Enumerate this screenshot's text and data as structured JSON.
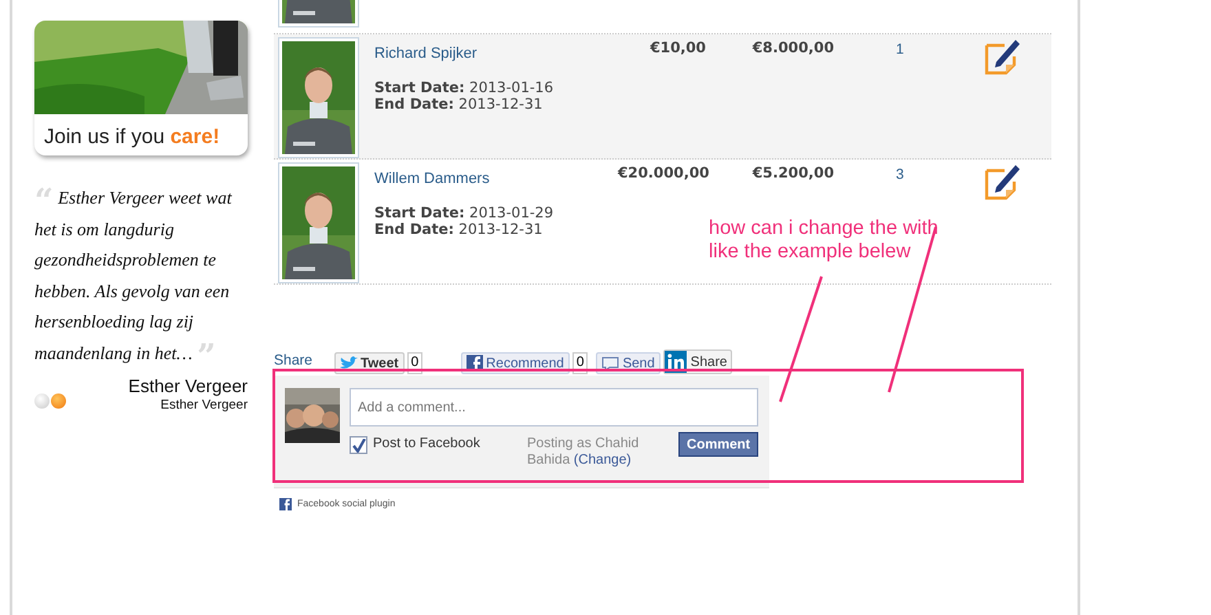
{
  "sidebar": {
    "banner": {
      "text": "Join us if you ",
      "highlight": "care!"
    },
    "quote_open": "“",
    "quote_close": "”",
    "quote": "Esther Vergeer weet wat het is om langdurig gezondheidsproblemen te hebben. Als gevolg van een hersenbloeding lag zij maandenlang in het…",
    "author": "Esther Vergeer",
    "author_subtitle": "Esther Vergeer",
    "slider_dots": [
      {
        "selected": false
      },
      {
        "selected": true
      }
    ]
  },
  "rows": [
    {
      "name": "Richard Spijker",
      "start_label": "Start Date:",
      "start": "2013-01-16",
      "end_label": "End Date:",
      "end": "2013-12-31",
      "amount_1": "€10,00",
      "amount_2": "€8.000,00",
      "count": "1"
    },
    {
      "name": "Willem Dammers",
      "start_label": "Start Date:",
      "start": "2013-01-29",
      "end_label": "End Date:",
      "end": "2013-12-31",
      "amount_1": "€20.000,00",
      "amount_2": "€5.200,00",
      "count": "3"
    }
  ],
  "share": {
    "label": "Share",
    "buttons": [
      {
        "kind": "twitter",
        "label": "Tweet",
        "count": "0"
      },
      {
        "kind": "facebook",
        "label": "Recommend",
        "count": "0"
      },
      {
        "kind": "send",
        "label": "Send"
      },
      {
        "kind": "linkedin",
        "label": "Share"
      }
    ]
  },
  "comment_box": {
    "placeholder": "Add a comment...",
    "post_to_facebook": {
      "label": "Post to Facebook",
      "checked": true
    },
    "posting_as": "Posting as Chahid Bahida",
    "change_link": "(Change)",
    "button": "Comment"
  },
  "footer": "Facebook social plugin",
  "annotation": {
    "lines": [
      "how can i change the with",
      "like the example belew"
    ]
  }
}
